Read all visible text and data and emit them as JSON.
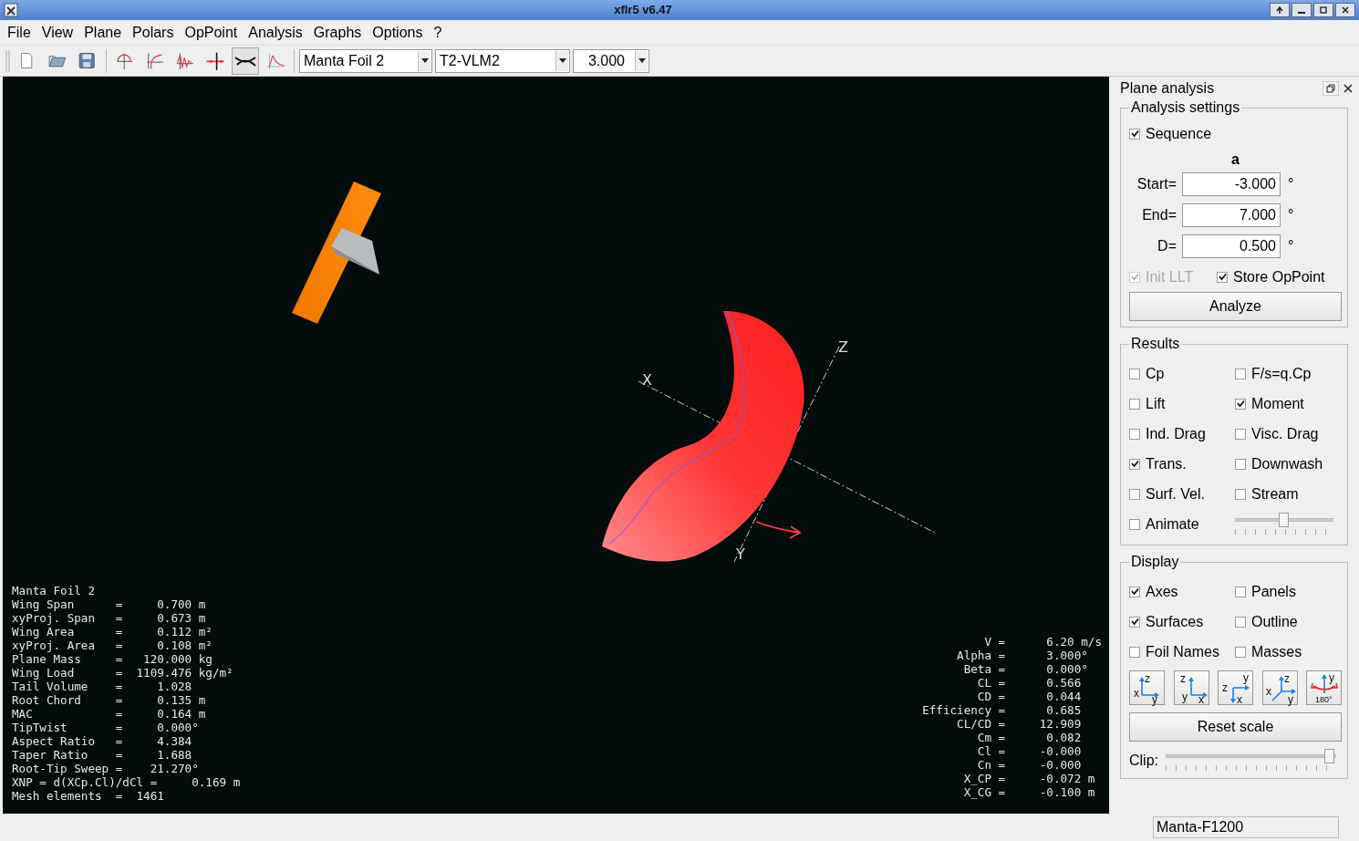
{
  "window": {
    "title": "xflr5 v6.47"
  },
  "menu": [
    {
      "label": "File"
    },
    {
      "label": "View"
    },
    {
      "label": "Plane"
    },
    {
      "label": "Polars"
    },
    {
      "label": "OpPoint"
    },
    {
      "label": "Analysis"
    },
    {
      "label": "Graphs"
    },
    {
      "label": "Options"
    },
    {
      "label": "?"
    }
  ],
  "toolbar": {
    "buttons": [
      {
        "kind": "new",
        "selected": false
      },
      {
        "kind": "open",
        "selected": false
      },
      {
        "kind": "save",
        "selected": false
      },
      {
        "kind": "foil",
        "selected": false
      },
      {
        "kind": "polar",
        "selected": false
      },
      {
        "kind": "wave",
        "selected": false
      },
      {
        "kind": "cross",
        "selected": false
      },
      {
        "kind": "plane",
        "selected": true
      },
      {
        "kind": "peak",
        "selected": false
      }
    ],
    "combos": [
      {
        "value": "Manta Foil 2"
      },
      {
        "value": "T2-VLM2"
      },
      {
        "value": "3.000"
      }
    ]
  },
  "viewport": {
    "axis_labels": [
      "X",
      "Z",
      "Y"
    ],
    "plane_info": {
      "title": "Manta Foil 2",
      "lines": [
        "Wing Span      =     0.700 m",
        "xyProj. Span   =     0.673 m",
        "Wing Area      =     0.112 m²",
        "xyProj. Area   =     0.108 m²",
        "Plane Mass     =   120.000 kg",
        "Wing Load      =  1109.476 kg/m²",
        "Tail Volume    =     1.028",
        "Root Chord     =     0.135 m",
        "MAC            =     0.164 m",
        "TipTwist       =     0.000°",
        "Aspect Ratio   =     4.384",
        "Taper Ratio    =     1.688",
        "Root-Tip Sweep =    21.270°",
        "XNP = d(XCp.Cl)/dCl =     0.169 m",
        "Mesh elements  =  1461"
      ]
    },
    "opp_info": [
      {
        "label": "V =",
        "value": "6.20 m/s"
      },
      {
        "label": "Alpha =",
        "value": "3.000°"
      },
      {
        "label": "Beta =",
        "value": "0.000°"
      },
      {
        "label": "CL =",
        "value": "0.566"
      },
      {
        "label": "CD =",
        "value": "0.044"
      },
      {
        "label": "Efficiency =",
        "value": "0.685"
      },
      {
        "label": "CL/CD =",
        "value": "12.909"
      },
      {
        "label": "Cm =",
        "value": "0.082"
      },
      {
        "label": "Cl =",
        "value": "-0.000"
      },
      {
        "label": "Cn =",
        "value": "-0.000"
      },
      {
        "label": "X_CP =",
        "value": "-0.072 m"
      },
      {
        "label": "X_CG =",
        "value": "-0.100 m"
      }
    ]
  },
  "panel": {
    "title": "Plane analysis",
    "settings": {
      "title": "Analysis settings",
      "sequence": {
        "label": "Sequence",
        "checked": true
      },
      "variable": "a",
      "fields": [
        {
          "label": "Start=",
          "value": "-3.000",
          "unit": "°"
        },
        {
          "label": "End=",
          "value": "7.000",
          "unit": "°"
        },
        {
          "label": "D=",
          "value": "0.500",
          "unit": "°"
        }
      ],
      "options": [
        {
          "label": "Init LLT",
          "checked": true,
          "disabled": true
        },
        {
          "label": "Store OpPoint",
          "checked": true,
          "disabled": false
        }
      ],
      "button": "Analyze"
    },
    "results": {
      "title": "Results",
      "checks": [
        {
          "label": "Cp",
          "checked": false
        },
        {
          "label": "F/s=q.Cp",
          "checked": false
        },
        {
          "label": "Lift",
          "checked": false
        },
        {
          "label": "Moment",
          "checked": true
        },
        {
          "label": "Ind. Drag",
          "checked": false
        },
        {
          "label": "Visc. Drag",
          "checked": false
        },
        {
          "label": "Trans.",
          "checked": true
        },
        {
          "label": "Downwash",
          "checked": false
        },
        {
          "label": "Surf. Vel.",
          "checked": false
        },
        {
          "label": "Stream",
          "checked": false
        },
        {
          "label": "Animate",
          "checked": false
        }
      ],
      "slider": {
        "level": 0.51
      }
    },
    "display": {
      "title": "Display",
      "checks": [
        {
          "label": "Axes",
          "checked": true
        },
        {
          "label": "Panels",
          "checked": false
        },
        {
          "label": "Surfaces",
          "checked": true
        },
        {
          "label": "Outline",
          "checked": false
        },
        {
          "label": "Foil Names",
          "checked": false
        },
        {
          "label": "Masses",
          "checked": false
        }
      ],
      "view_buttons": [
        {
          "kind": "a",
          "labels": [
            "z",
            "x",
            "y"
          ]
        },
        {
          "kind": "b",
          "labels": [
            "z",
            "y",
            "x"
          ]
        },
        {
          "kind": "c",
          "labels": [
            "y",
            "z",
            "x"
          ]
        },
        {
          "kind": "d",
          "labels": [
            "z",
            "x",
            "y"
          ]
        },
        {
          "kind": "flip",
          "labels": [
            "y",
            "180°"
          ]
        }
      ],
      "reset": "Reset scale",
      "clip": {
        "label": "Clip:",
        "level": 1
      }
    }
  },
  "status": "Manta-F1200"
}
